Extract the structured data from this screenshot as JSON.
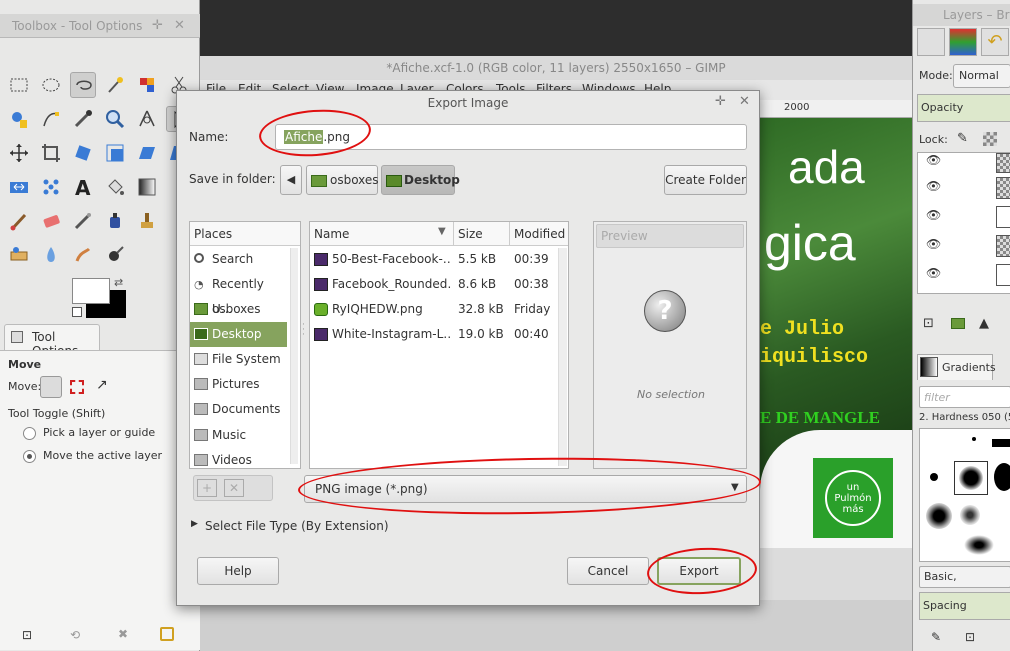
{
  "toolbox": {
    "title": "Toolbox - Tool Options",
    "tab_label": "Tool Options",
    "section": "Move",
    "move_label": "Move:",
    "toggle_label": "Tool Toggle  (Shift)",
    "radio1": "Pick a layer or guide",
    "radio2": "Move the active layer"
  },
  "imgwin": {
    "title": "*Afiche.xcf-1.0 (RGB color, 11 layers) 2550x1650 – GIMP",
    "menus": [
      "File",
      "Edit",
      "Select",
      "View",
      "Image",
      "Layer",
      "Colors",
      "Tools",
      "Filters",
      "Windows",
      "Help"
    ],
    "ruler_mark": "2000",
    "canvas_text1": "ada",
    "canvas_text2": "gica",
    "canvas_text3": "e Julio",
    "canvas_text4": "iquilisco",
    "canvas_text5": "E DE MANGLE",
    "logo": "un Pulmón más"
  },
  "dock": {
    "title": "Layers – Br",
    "mode_label": "Mode:",
    "mode_value": "Normal",
    "opacity_label": "Opacity",
    "lock_label": "Lock:",
    "gradients_tab": "Gradients",
    "filter_placeholder": "filter",
    "brush_name": "2. Hardness 050 (5",
    "preset": "Basic,",
    "spacing": "Spacing"
  },
  "dialog": {
    "title": "Export Image",
    "name_label": "Name:",
    "name_value": "Afiche.png",
    "name_selected_part": "Afiche",
    "name_rest": ".png",
    "save_in_label": "Save in folder:",
    "crumbs": [
      "osboxes",
      "Desktop"
    ],
    "create_folder": "Create Folder",
    "places_header": "Places",
    "places": [
      "Search",
      "Recently U…",
      "osboxes",
      "Desktop",
      "File System",
      "Pictures",
      "Documents",
      "Music",
      "Videos"
    ],
    "columns": {
      "name": "Name",
      "size": "Size",
      "modified": "Modified"
    },
    "files": [
      {
        "name": "50-Best-Facebook-…",
        "size": "5.5 kB",
        "modified": "00:39"
      },
      {
        "name": "Facebook_Rounded…",
        "size": "8.6 kB",
        "modified": "00:38"
      },
      {
        "name": "RyIQHEDW.png",
        "size": "32.8 kB",
        "modified": "Friday"
      },
      {
        "name": "White-Instagram-L…",
        "size": "19.0 kB",
        "modified": "00:40"
      }
    ],
    "preview_header": "Preview",
    "no_selection": "No selection",
    "filetype": "PNG image (*.png)",
    "select_file_type": "Select File Type (By Extension)",
    "help": "Help",
    "cancel": "Cancel",
    "export": "Export"
  },
  "colors": {
    "selected_place": "#86a35e",
    "annotation": "#e01010"
  }
}
